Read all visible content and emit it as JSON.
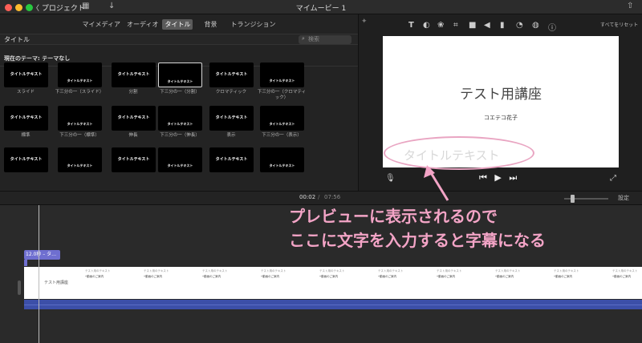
{
  "window": {
    "back_label": "〈 プロジェクト",
    "title": "マイムービー 1"
  },
  "colors": {
    "accent_pink": "#f3a4c6",
    "clip_purple": "#6f6fd0",
    "audio_blue": "#3c4fa8"
  },
  "browser": {
    "tabs": [
      "マイメディア",
      "オーディオ",
      "タイトル",
      "背景",
      "トランジション"
    ],
    "active_tab": "タイトル",
    "section_label": "タイトル",
    "search_placeholder": "検索",
    "theme_label": "現在のテーマ: テーマなし",
    "thumb_text": "タイトルテキスト",
    "thumb_sub": "ここにテキストを入力",
    "captions": [
      "スライド",
      "下三分の一（スライド）",
      "分割",
      "下三分の一（分割）",
      "クロマティック",
      "下三分の一（クロマティック）",
      "標準",
      "下三分の一（標準）",
      "伸長",
      "下三分の一（伸長）",
      "表示",
      "下三分の一（表示）",
      "",
      "",
      "",
      "",
      "",
      ""
    ]
  },
  "viewer": {
    "reset_label": "すべてをリセット",
    "preview_title": "テスト用講座",
    "preview_subtitle": "コエテコ花子",
    "placeholder_text": "タイトルテキスト"
  },
  "timecode": {
    "current": "00:02",
    "separator": "/",
    "total": "07:56",
    "settings_label": "設定"
  },
  "timeline": {
    "title_clip_label": "12.0秒 – タ…",
    "video_clip_label": "テスト用講座",
    "frame_top": "テスト用のテキスト",
    "frame_bottom": "•動画のご案内"
  },
  "annotation": {
    "line1": "プレビューに表示されるので",
    "line2": "ここに文字を入力すると字幕になる"
  }
}
